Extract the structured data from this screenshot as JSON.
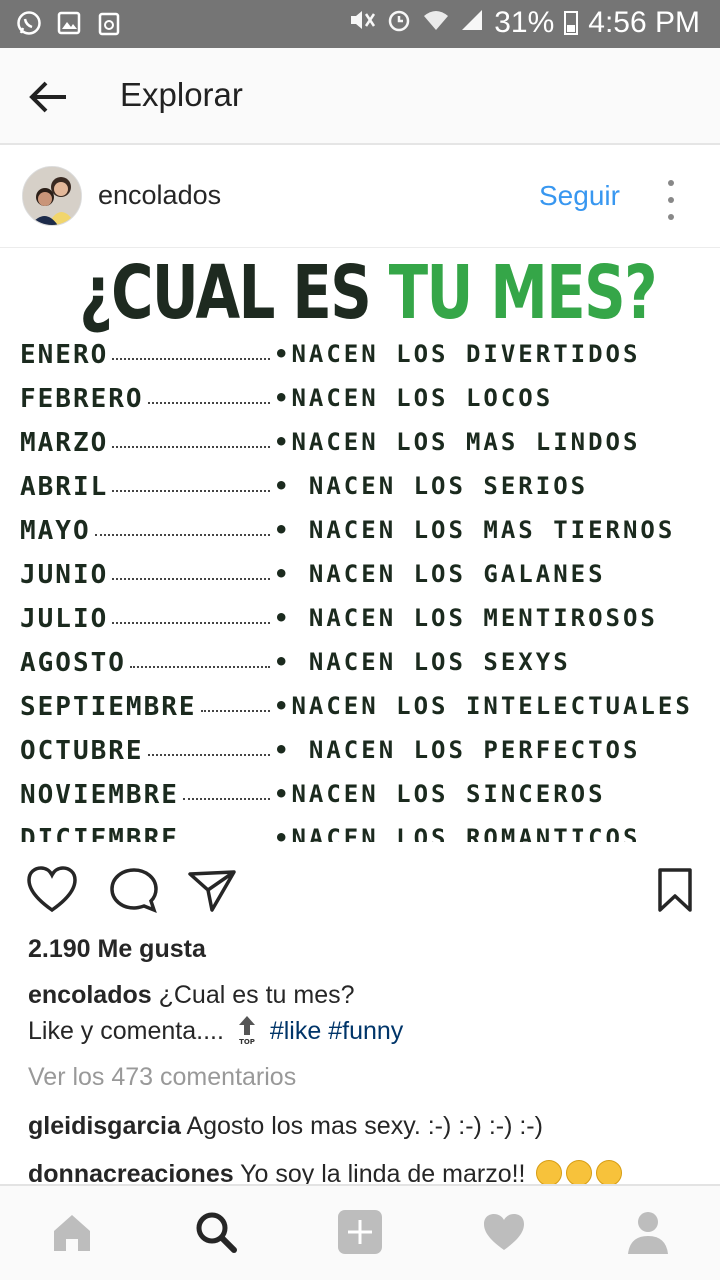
{
  "status_bar": {
    "battery": "31%",
    "time": "4:56 PM",
    "left_icons": [
      "whatsapp-icon",
      "gallery-icon",
      "recycle-icon"
    ],
    "right_icons": [
      "mute-icon",
      "alarm-icon",
      "wifi-icon",
      "signal-icon",
      "battery-icon"
    ]
  },
  "header": {
    "title": "Explorar",
    "back_icon": "arrow-left-icon"
  },
  "post": {
    "username": "encolados",
    "follow_label": "Seguir",
    "image": {
      "title_dark": "¿CUAL ES ",
      "title_green": "TU MES?",
      "rows": [
        {
          "month": "ENERO",
          "desc": "•NACEN LOS DIVERTIDOS"
        },
        {
          "month": "FEBRERO",
          "desc": "•NACEN LOS LOCOS"
        },
        {
          "month": "MARZO",
          "desc": "•NACEN LOS MAS LINDOS"
        },
        {
          "month": "ABRIL",
          "desc": "• NACEN LOS SERIOS"
        },
        {
          "month": "MAYO",
          "desc": "• NACEN LOS MAS TIERNOS"
        },
        {
          "month": "JUNIO",
          "desc": "• NACEN LOS GALANES"
        },
        {
          "month": "JULIO",
          "desc": "• NACEN LOS MENTIROSOS"
        },
        {
          "month": "AGOSTO",
          "desc": "• NACEN LOS SEXYS"
        },
        {
          "month": "SEPTIEMBRE",
          "desc": "•NACEN LOS INTELECTUALES"
        },
        {
          "month": "OCTUBRE",
          "desc": "• NACEN LOS PERFECTOS"
        },
        {
          "month": "NOVIEMBRE",
          "desc": "•NACEN LOS SINCEROS"
        },
        {
          "month": "DICIEMBRE",
          "desc": "•NACEN LOS ROMANTICOS"
        }
      ]
    },
    "likes": "2.190 Me gusta",
    "caption_user": "encolados",
    "caption_line1": "¿Cual es tu mes?",
    "caption_line2": "Like y comenta....",
    "hashtag_like": "#like",
    "hashtag_funny": "#funny",
    "view_comments": "Ver los 473 comentarios",
    "comments": [
      {
        "user": "gleidisgarcia",
        "text": "Agosto los mas sexy. :-) :-) :-) :-)"
      },
      {
        "user": "donnacreaciones",
        "text": "Yo soy la linda de marzo!!"
      }
    ]
  },
  "bottom_nav": [
    "home-icon",
    "search-icon",
    "add-post-icon",
    "activity-heart-icon",
    "profile-icon"
  ]
}
